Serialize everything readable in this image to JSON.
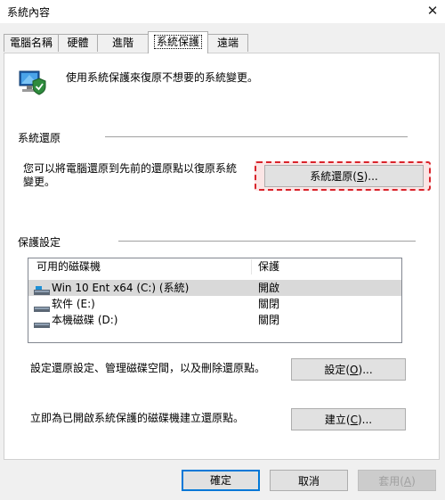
{
  "window": {
    "title": "系統內容",
    "close_glyph": "✕"
  },
  "tabs": [
    {
      "label": "電腦名稱",
      "active": false
    },
    {
      "label": "硬體",
      "active": false
    },
    {
      "label": "進階",
      "active": false
    },
    {
      "label": "系統保護",
      "active": true
    },
    {
      "label": "遠端",
      "active": false
    }
  ],
  "intro": {
    "text": "使用系統保護來復原不想要的系統變更。",
    "icon": "system-protection-icon"
  },
  "restore_section": {
    "heading": "系統還原",
    "description_line1": "您可以將電腦還原到先前的還原點以復原系統",
    "description_line2": "變更。",
    "button_label": "系統還原",
    "button_key": "S",
    "button_suffix": "...",
    "highlight_color": "#d9232a"
  },
  "protection_section": {
    "heading": "保護設定",
    "columns": [
      "可用的磁碟機",
      "保護"
    ],
    "drives": [
      {
        "name": "Win 10 Ent x64 (C:) (系統)",
        "protection": "開啟",
        "icon": "system-drive-icon",
        "selected": true
      },
      {
        "name": "软件 (E:)",
        "protection": "關閉",
        "icon": "drive-icon",
        "selected": false
      },
      {
        "name": "本機磁碟 (D:)",
        "protection": "關閉",
        "icon": "drive-icon",
        "selected": false
      }
    ],
    "configure_text": "設定還原設定、管理磁碟空間，以及刪除還原點。",
    "configure_label": "設定",
    "configure_key": "O",
    "configure_suffix": "...",
    "create_text": "立即為已開啟系統保護的磁碟機建立還原點。",
    "create_label": "建立",
    "create_key": "C",
    "create_suffix": "..."
  },
  "footer": {
    "ok_label": "確定",
    "cancel_label": "取消",
    "apply_label": "套用",
    "apply_key": "A",
    "accent_color": "#0078d7"
  }
}
